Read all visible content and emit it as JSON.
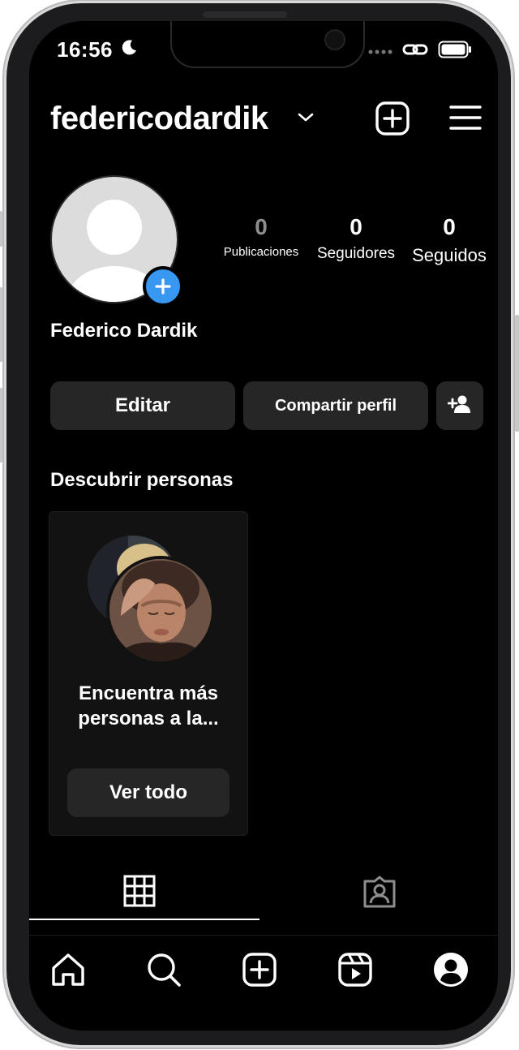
{
  "status_bar": {
    "time": "16:56"
  },
  "header": {
    "username": "federicodardik"
  },
  "profile": {
    "display_name": "Federico Dardik",
    "stats": [
      {
        "value": "0",
        "label": "Publicaciones"
      },
      {
        "value": "0",
        "label": "Seguidores"
      },
      {
        "value": "0",
        "label": "Seguidos"
      }
    ]
  },
  "actions": {
    "edit": "Editar",
    "share": "Compartir perfil"
  },
  "discover": {
    "title": "Descubrir personas",
    "card_text_line1": "Encuentra más",
    "card_text_line2": "personas a la...",
    "card_button": "Ver todo"
  },
  "tabs": [
    {
      "icon": "grid-icon",
      "active": true
    },
    {
      "icon": "tagged-icon",
      "active": false
    }
  ],
  "bottom_nav": [
    {
      "icon": "home-icon"
    },
    {
      "icon": "search-icon"
    },
    {
      "icon": "create-icon"
    },
    {
      "icon": "reels-icon"
    },
    {
      "icon": "profile-icon"
    }
  ],
  "colors": {
    "background": "#000000",
    "button": "#262626",
    "accent_blue": "#3897f0"
  }
}
